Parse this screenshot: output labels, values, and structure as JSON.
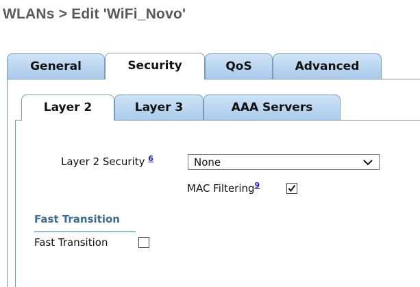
{
  "page": {
    "title": "WLANs > Edit  'WiFi_Novo'"
  },
  "outer_tabs": [
    {
      "label": "General",
      "active": false
    },
    {
      "label": "Security",
      "active": true
    },
    {
      "label": "QoS",
      "active": false
    },
    {
      "label": "Advanced",
      "active": false
    }
  ],
  "inner_tabs": [
    {
      "label": "Layer 2",
      "active": true
    },
    {
      "label": "Layer 3",
      "active": false
    },
    {
      "label": "AAA Servers",
      "active": false
    }
  ],
  "layer2_security": {
    "label": "Layer 2 Security",
    "footnote": "6",
    "value": "None"
  },
  "mac_filtering": {
    "label": "MAC Filtering",
    "footnote": "9",
    "checked": true
  },
  "fast_transition": {
    "heading": "Fast Transition",
    "label": "Fast Transition",
    "checked": false
  },
  "colors": {
    "tab_fill": "#a9cbeb",
    "tab_border": "#7a9ab8",
    "heading_text": "#3d6e93",
    "footnote_link": "#1a1aee",
    "title_text": "#595959"
  }
}
